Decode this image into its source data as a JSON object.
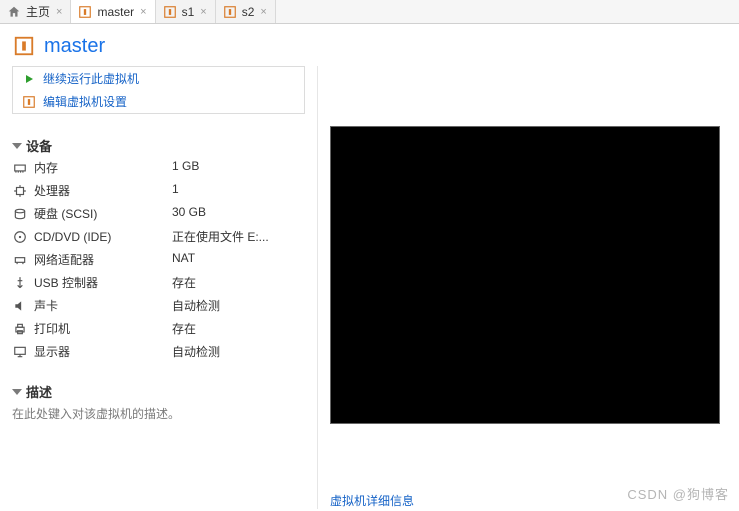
{
  "tabs": [
    {
      "label": "主页",
      "icon": "home"
    },
    {
      "label": "master",
      "icon": "vm",
      "active": true
    },
    {
      "label": "s1",
      "icon": "vm"
    },
    {
      "label": "s2",
      "icon": "vm"
    }
  ],
  "page_title": "master",
  "actions": {
    "resume": "继续运行此虚拟机",
    "edit": "编辑虚拟机设置"
  },
  "sections": {
    "devices_title": "设备",
    "description_title": "描述"
  },
  "devices": [
    {
      "icon": "memory",
      "name": "内存",
      "value": "1 GB"
    },
    {
      "icon": "cpu",
      "name": "处理器",
      "value": "1"
    },
    {
      "icon": "disk",
      "name": "硬盘 (SCSI)",
      "value": "30 GB"
    },
    {
      "icon": "cd",
      "name": "CD/DVD (IDE)",
      "value": "正在使用文件 E:..."
    },
    {
      "icon": "net",
      "name": "网络适配器",
      "value": "NAT"
    },
    {
      "icon": "usb",
      "name": "USB 控制器",
      "value": "存在"
    },
    {
      "icon": "sound",
      "name": "声卡",
      "value": "自动检测"
    },
    {
      "icon": "printer",
      "name": "打印机",
      "value": "存在"
    },
    {
      "icon": "display",
      "name": "显示器",
      "value": "自动检测"
    }
  ],
  "description_placeholder": "在此处键入对该虚拟机的描述。",
  "bottom_link": "虚拟机详细信息",
  "watermark": "CSDN @狗博客"
}
